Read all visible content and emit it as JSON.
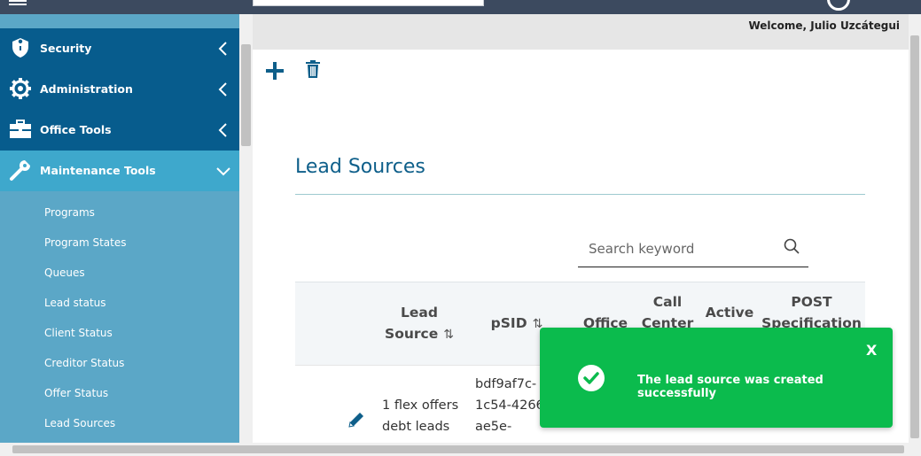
{
  "header": {
    "welcome": "Welcome, Julio Uzcátegui"
  },
  "sidebar": {
    "items": [
      {
        "label": "Security",
        "icon": "shield-icon",
        "expanded": false
      },
      {
        "label": "Administration",
        "icon": "gear-icon",
        "expanded": false
      },
      {
        "label": "Office Tools",
        "icon": "toolbox-icon",
        "expanded": false
      },
      {
        "label": "Maintenance Tools",
        "icon": "wrench-icon",
        "expanded": true
      }
    ],
    "subitems": [
      "Programs",
      "Program States",
      "Queues",
      "Lead status",
      "Client Status",
      "Creditor Status",
      "Offer Status",
      "Lead Sources"
    ]
  },
  "main": {
    "title": "Lead Sources",
    "search": {
      "placeholder": "Search keyword",
      "value": ""
    },
    "toolbar": {
      "add_icon": "plus-icon",
      "delete_icon": "trash-icon"
    },
    "table": {
      "columns": [
        {
          "line1": "Lead",
          "line2": "Source",
          "sortable": true
        },
        {
          "line1": "pSID",
          "line2": "",
          "sortable": true
        },
        {
          "line1": "Office",
          "line2": "",
          "sortable": false
        },
        {
          "line1": "Call",
          "line2": "Center",
          "sortable": false
        },
        {
          "line1": "Active",
          "line2": "",
          "sortable": false
        },
        {
          "line1": "POST",
          "line2": "Specification",
          "sortable": false
        }
      ],
      "rows": [
        {
          "lead_source_l1": "1 flex offers",
          "lead_source_l2": "debt leads",
          "psid_l1": "bdf9af7c-",
          "psid_l2": "1c54-4266-",
          "psid_l3": "ae5e-"
        }
      ]
    }
  },
  "toast": {
    "message": "The lead source was created successfully",
    "close": "X",
    "color": "#0bbb4d"
  },
  "colors": {
    "sidebar_dark": "#075c8d",
    "sidebar_active": "#3ea8cc",
    "sidebar_sub": "#5ba7c7",
    "title": "#0e5f8a"
  }
}
